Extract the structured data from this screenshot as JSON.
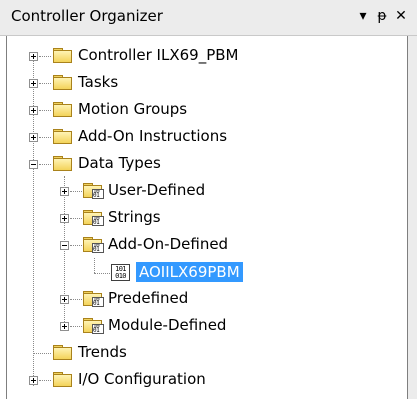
{
  "window": {
    "title": "Controller Organizer",
    "dropdown_glyph": "▾",
    "pin_glyph": "ᵽ",
    "close_glyph": "✕"
  },
  "tree": {
    "controller": {
      "label": "Controller ILX69_PBM",
      "expanded": false
    },
    "tasks": {
      "label": "Tasks",
      "expanded": false
    },
    "motion_groups": {
      "label": "Motion Groups",
      "expanded": false
    },
    "add_on_instructions": {
      "label": "Add-On Instructions",
      "expanded": false
    },
    "data_types": {
      "label": "Data Types",
      "expanded": true,
      "children": {
        "user_defined": {
          "label": "User-Defined",
          "expanded": false
        },
        "strings": {
          "label": "Strings",
          "expanded": false
        },
        "add_on_defined": {
          "label": "Add-On-Defined",
          "expanded": true,
          "children": {
            "item": {
              "label": "AOIILX69PBM",
              "selected": true,
              "icon_text": "101 010"
            }
          }
        },
        "predefined": {
          "label": "Predefined",
          "expanded": false
        },
        "module_defined": {
          "label": "Module-Defined",
          "expanded": false
        }
      }
    },
    "trends": {
      "label": "Trends"
    },
    "io_configuration": {
      "label": "I/O Configuration",
      "expanded": false
    }
  },
  "colors": {
    "selection": "#3399ff",
    "folder_fill": "#f3d35a",
    "titlebar": "#ececec"
  },
  "icons": [
    "folder-icon",
    "data-type-folder-icon",
    "data-type-icon",
    "expand-icon",
    "collapse-icon",
    "pin-icon",
    "close-icon",
    "dropdown-icon"
  ]
}
